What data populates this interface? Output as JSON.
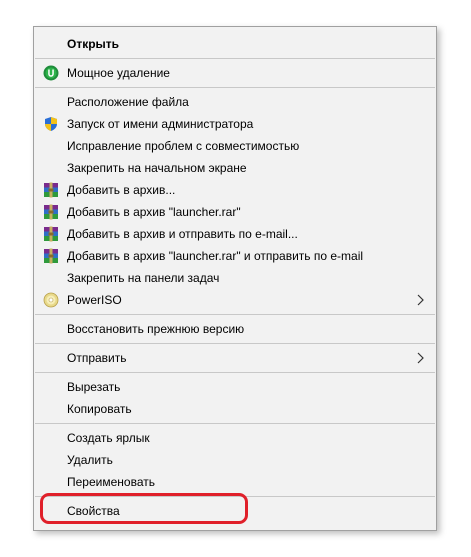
{
  "context_menu": {
    "open": "Открыть",
    "powerful_delete": "Мощное удаление",
    "file_location": "Расположение файла",
    "run_as_admin": "Запуск от имени администратора",
    "troubleshoot_compat": "Исправление проблем с совместимостью",
    "pin_to_start": "Закрепить на начальном экране",
    "add_to_archive": "Добавить в архив...",
    "add_to_archive_named": "Добавить в архив \"launcher.rar\"",
    "add_to_archive_email": "Добавить в архив и отправить по e-mail...",
    "add_to_archive_named_email": "Добавить в архив \"launcher.rar\" и отправить по e-mail",
    "pin_to_taskbar": "Закрепить на панели задач",
    "poweriso": "PowerISO",
    "restore_previous": "Восстановить прежнюю версию",
    "send_to": "Отправить",
    "cut": "Вырезать",
    "copy": "Копировать",
    "create_shortcut": "Создать ярлык",
    "delete": "Удалить",
    "rename": "Переименовать",
    "properties": "Свойства"
  },
  "icons": {
    "powerful_delete": "uninstaller-icon",
    "run_as_admin": "shield-icon",
    "archive": "winrar-icon",
    "poweriso": "disc-icon",
    "submenu": "chevron-right-icon"
  },
  "colors": {
    "menu_bg": "#f2f2f2",
    "highlight": "#e0202a",
    "uninstaller_green": "#1e8c3a"
  }
}
